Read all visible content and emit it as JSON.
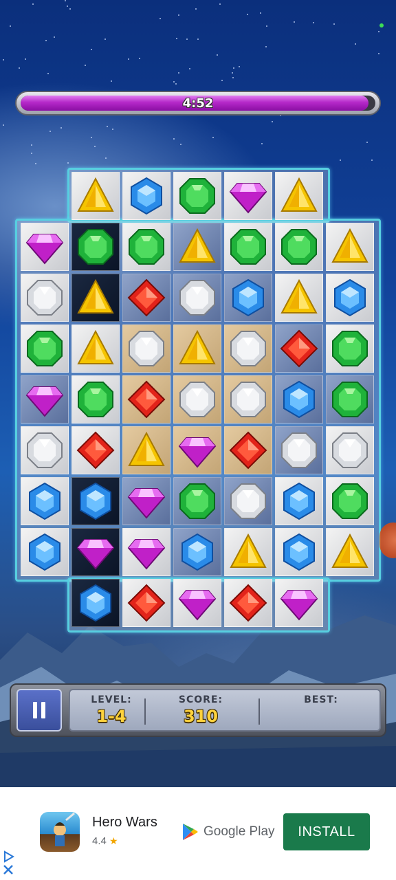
{
  "timer": {
    "text": "4:52",
    "fraction": 0.98,
    "fill_color": "#b528c9"
  },
  "board": {
    "rows": [
      [
        null,
        "yellow-triangle",
        "blue-hexagon",
        "green-octagon",
        "purple-diamond",
        "yellow-triangle",
        null
      ],
      [
        "purple-diamond",
        "green-octagon",
        "green-octagon",
        "yellow-triangle",
        "green-octagon",
        "green-octagon",
        "yellow-triangle"
      ],
      [
        "white-round",
        "yellow-triangle",
        "red-square",
        "white-round",
        "blue-hexagon",
        "yellow-triangle",
        "blue-hexagon"
      ],
      [
        "green-octagon",
        "yellow-triangle",
        "white-round",
        "yellow-triangle",
        "white-round",
        "red-square",
        "green-octagon"
      ],
      [
        "purple-diamond",
        "green-octagon",
        "red-square",
        "white-round",
        "white-round",
        "blue-hexagon",
        "green-octagon"
      ],
      [
        "white-round",
        "red-square",
        "yellow-triangle",
        "purple-diamond",
        "red-square",
        "white-round",
        "white-round"
      ],
      [
        "blue-hexagon",
        "blue-hexagon",
        "purple-diamond",
        "green-octagon",
        "white-round",
        "blue-hexagon",
        "green-octagon"
      ],
      [
        "blue-hexagon",
        "purple-diamond",
        "purple-diamond",
        "blue-hexagon",
        "yellow-triangle",
        "blue-hexagon",
        "yellow-triangle"
      ],
      [
        null,
        "blue-hexagon",
        "red-square",
        "purple-diamond",
        "red-square",
        "purple-diamond",
        null
      ]
    ],
    "tiles": [
      [
        null,
        "light",
        "light",
        "light",
        "light",
        "light",
        null
      ],
      [
        "light",
        "dark",
        "light",
        "blue",
        "light",
        "light",
        "light"
      ],
      [
        "light",
        "dark",
        "blue",
        "blue",
        "blue",
        "light",
        "light"
      ],
      [
        "light",
        "light",
        "tan",
        "tan",
        "tan",
        "blue",
        "light"
      ],
      [
        "blue",
        "light",
        "tan",
        "tan",
        "tan",
        "blue",
        "blue"
      ],
      [
        "light",
        "light",
        "tan",
        "tan",
        "tan",
        "blue",
        "light"
      ],
      [
        "light",
        "dark",
        "blue",
        "blue",
        "blue",
        "light",
        "light"
      ],
      [
        "light",
        "dark",
        "light",
        "blue",
        "light",
        "light",
        "light"
      ],
      [
        null,
        "dark",
        "light",
        "light",
        "light",
        "light",
        null
      ]
    ]
  },
  "hud": {
    "pause_icon": "pause-icon",
    "level_label": "LEVEL:",
    "level_value": "1-4",
    "score_label": "SCORE:",
    "score_value": "310",
    "best_label": "BEST:",
    "best_value": ""
  },
  "ad": {
    "app_name": "Hero Wars",
    "rating": "4.4",
    "store_name": "Google Play",
    "install_label": "INSTALL",
    "install_color": "#1a7a4b"
  }
}
